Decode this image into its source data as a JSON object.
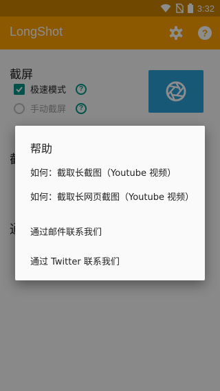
{
  "status_bar": {
    "time": "3:32"
  },
  "app_bar": {
    "title": "LongShot"
  },
  "main": {
    "section1_title": "截屏",
    "option_fast": "极速模式",
    "option_manual": "手动截屏",
    "partial_a": "截",
    "partial_b": "通"
  },
  "dialog": {
    "title": "帮助",
    "items": [
      "如何：截取长截图（Youtube 视频）",
      "如何：截取长网页截图（Youtube 视频）",
      "通过邮件联系我们",
      "通过 Twitter 联系我们"
    ]
  },
  "colors": {
    "status_bar": "#cc8400",
    "app_bar": "#ffa000",
    "accent": "#009688",
    "capture_button": "#29a1d6"
  }
}
